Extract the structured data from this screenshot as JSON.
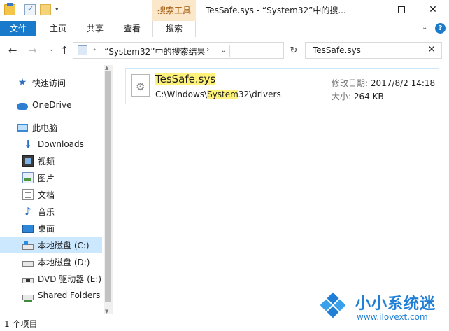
{
  "window": {
    "title": "TesSafe.sys - “System32”中的搜...",
    "context_tab": "搜索工具",
    "buttons": {
      "minimize": "—",
      "maximize": "☐",
      "close": "✕"
    }
  },
  "ribbon": {
    "tabs": [
      {
        "label": "文件",
        "active": true
      },
      {
        "label": "主页"
      },
      {
        "label": "共享"
      },
      {
        "label": "查看"
      },
      {
        "label": "搜索"
      }
    ],
    "expand_icon": "chevron-down-icon",
    "help_label": "?"
  },
  "navigation": {
    "back": "←",
    "forward": "→",
    "recent": "⌄",
    "up": "↑"
  },
  "address": {
    "path": "“System32”中的搜索结果",
    "sep": "›",
    "dropdown": "⌄",
    "refresh": "↻"
  },
  "search": {
    "value": "TesSafe.sys",
    "clear": "✕"
  },
  "sidebar": {
    "items": [
      {
        "label": "快速访问",
        "icon": "star-icon"
      },
      {
        "label": "OneDrive",
        "icon": "cloud-icon"
      },
      {
        "label": "此电脑",
        "icon": "computer-icon"
      },
      {
        "label": "Downloads",
        "icon": "download-icon"
      },
      {
        "label": "视频",
        "icon": "video-icon"
      },
      {
        "label": "图片",
        "icon": "picture-icon"
      },
      {
        "label": "文档",
        "icon": "document-icon"
      },
      {
        "label": "音乐",
        "icon": "music-icon"
      },
      {
        "label": "桌面",
        "icon": "desktop-icon"
      },
      {
        "label": "本地磁盘 (C:)",
        "icon": "drive-icon",
        "selected": true
      },
      {
        "label": "本地磁盘 (D:)",
        "icon": "drive-icon"
      },
      {
        "label": "DVD 驱动器 (E:)",
        "icon": "dvd-icon"
      },
      {
        "label": "Shared Folders",
        "icon": "shared-folder-icon"
      }
    ]
  },
  "result": {
    "name": "TesSafe.sys",
    "path_prefix": "C:\\Windows\\",
    "path_highlight": "System",
    "path_suffix": "32\\drivers",
    "date_label": "修改日期:",
    "date_value": "2017/8/2 14:18",
    "size_label": "大小:",
    "size_value": "264 KB",
    "highlight_color": "#fff27a"
  },
  "status": {
    "count": "1 个项目"
  },
  "watermark": {
    "title": "小小系统迷",
    "url": "www.ilovext.com"
  }
}
